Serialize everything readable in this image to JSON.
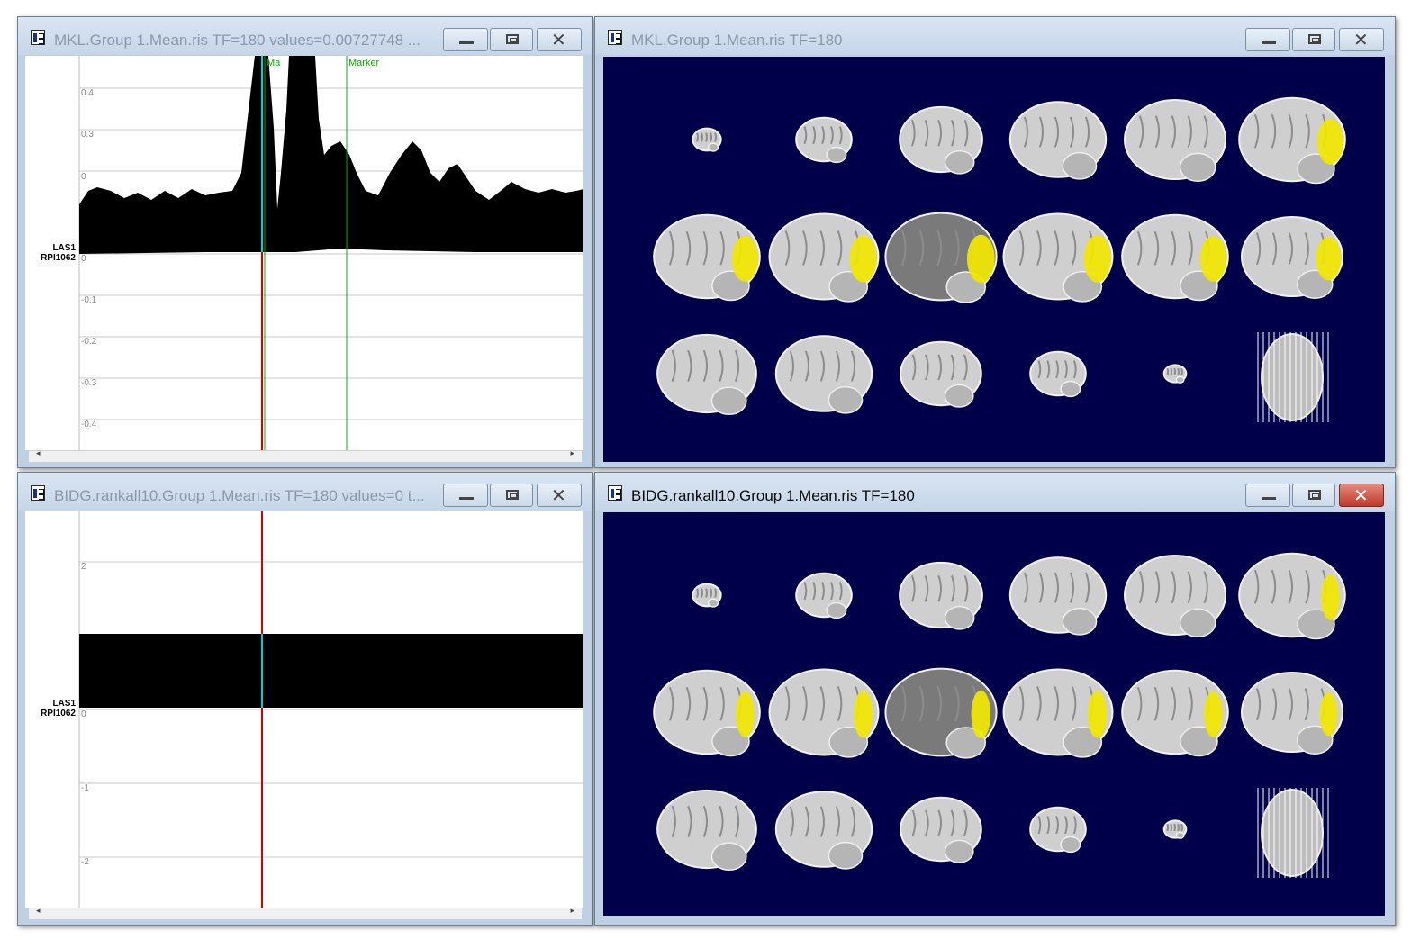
{
  "windows": {
    "tl": {
      "title": "MKL.Group 1.Mean.ris   TF=180   values=0.00727748 ..."
    },
    "tr": {
      "title": "MKL.Group 1.Mean.ris    TF=180"
    },
    "bl": {
      "title": "BIDG.rankall10.Group 1.Mean.ris    TF=180    values=0 t..."
    },
    "br": {
      "title": "BIDG.rankall10.Group 1.Mean.ris    TF=180"
    }
  },
  "tl_plot": {
    "channel_top": "LAS1",
    "channel_bottom": "RPI1062",
    "ticks": [
      "0.4",
      "0.3",
      "0",
      "0",
      "-0.1",
      "-0.2",
      "-0.3",
      "-0.4"
    ],
    "markers": [
      {
        "label": "Ma"
      },
      {
        "label": "Marker"
      }
    ]
  },
  "bl_plot": {
    "channel_top": "LAS1",
    "channel_bottom": "RPI1062",
    "ticks": [
      "2",
      "0",
      "-1",
      "-2"
    ]
  },
  "colors": {
    "cursor": "#d40000",
    "cursor_highlight": "#00d0d0",
    "marker": "#00b000",
    "overlay": "#f2e700",
    "brain_bg": "#00004a",
    "trace": "#000000"
  },
  "scrollbar": {
    "left_arrow": "◂",
    "right_arrow": "▸"
  },
  "icons": {
    "app": "cartool-icon",
    "min": "minimize-icon",
    "max": "maximize-icon",
    "close": "close-icon"
  }
}
